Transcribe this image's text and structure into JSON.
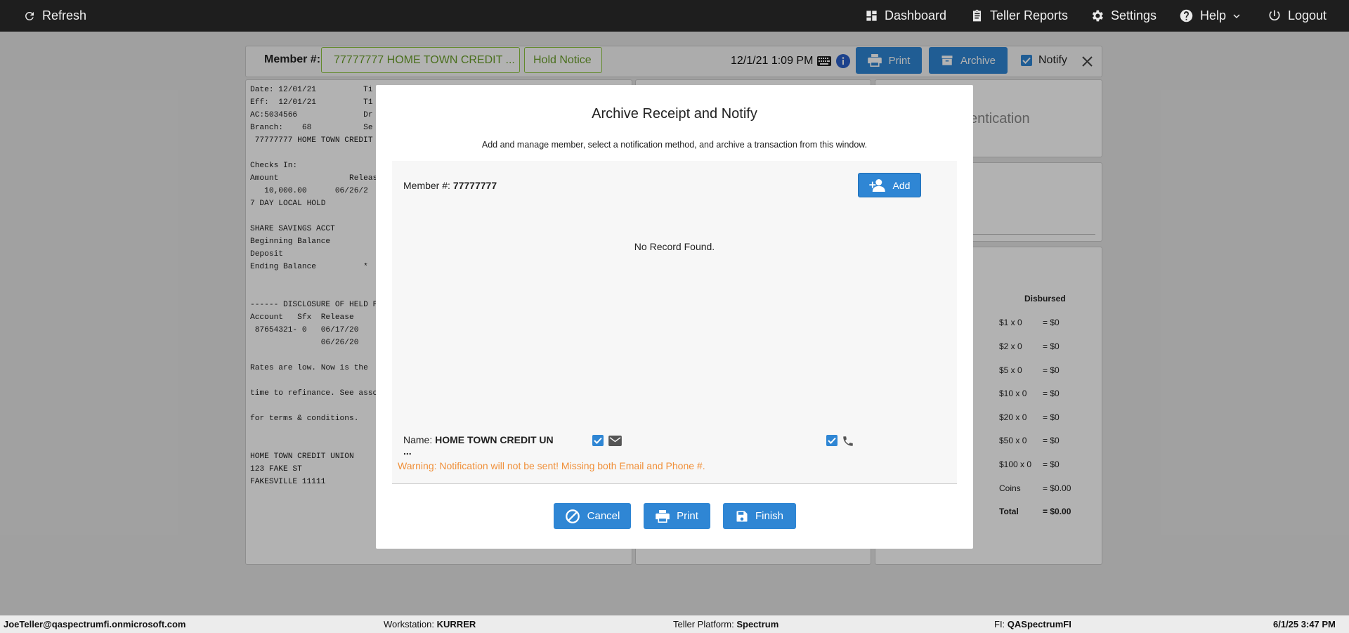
{
  "topbar": {
    "refresh": "Refresh",
    "dashboard": "Dashboard",
    "teller_reports": "Teller Reports",
    "settings": "Settings",
    "help": "Help",
    "logout": "Logout"
  },
  "toolbar": {
    "member_label": "Member #:",
    "member_value": "77777777 HOME TOWN CREDIT ...",
    "hold_notice": "Hold Notice",
    "datetime": "12/1/21 1:09 PM",
    "print": "Print",
    "archive": "Archive",
    "notify": "Notify"
  },
  "receipt_lines": [
    "Date: 12/01/21          Ti",
    "Eff:  12/01/21          T1",
    "AC:5034566              Dr",
    "Branch:    68           Se",
    " 77777777 HOME TOWN CREDIT",
    "",
    "Checks In:",
    "Amount               Releas",
    "   10,000.00      06/26/2",
    "7 DAY LOCAL HOLD",
    "",
    "SHARE SAVINGS ACCT",
    "Beginning Balance",
    "Deposit",
    "Ending Balance          *",
    "",
    "",
    "------ DISCLOSURE OF HELD F",
    "Account   Sfx  Release",
    " 87654321- 0   06/17/20",
    "               06/26/20",
    "",
    "Rates are low. Now is the",
    "",
    "time to refinance. See asso",
    "",
    "for terms & conditions.",
    "",
    "",
    "HOME TOWN CREDIT UNION",
    "123 FAKE ST",
    "FAKESVILLE 11111"
  ],
  "right_panel": {
    "auth_text": "entication",
    "disbursed_header": "Disbursed",
    "rows": [
      {
        "label": "$1 x 0",
        "value": "= $0"
      },
      {
        "label": "$2 x 0",
        "value": "= $0"
      },
      {
        "label": "$5 x 0",
        "value": "= $0"
      },
      {
        "label": "$10 x 0",
        "value": "= $0"
      },
      {
        "label": "$20 x 0",
        "value": "= $0"
      },
      {
        "label": "$50 x 0",
        "value": "= $0"
      },
      {
        "label": "$100 x 0",
        "value": "= $0"
      },
      {
        "label": "Coins",
        "value": "= $0.00"
      },
      {
        "label": "Total",
        "value": "= $0.00"
      }
    ]
  },
  "modal": {
    "title": "Archive Receipt and Notify",
    "subtitle": "Add and manage member, select a notification method, and archive a transaction from this window.",
    "member_label": "Member #:",
    "member_value": "77777777",
    "add": "Add",
    "no_record": "No Record Found.",
    "name_label": "Name:",
    "name_value": "HOME TOWN CREDIT UN",
    "name_more": "...",
    "warning": "Warning: Notification will not be sent! Missing both Email and Phone #.",
    "warning_color": "#f0903a",
    "cancel": "Cancel",
    "print": "Print",
    "finish": "Finish"
  },
  "statusbar": {
    "user": "JoeTeller@qaspectrumfi.onmicrosoft.com",
    "workstation_label": "Workstation:",
    "workstation": "KURRER",
    "platform_label": "Teller Platform:",
    "platform": "Spectrum",
    "fi_label": "FI:",
    "fi": "QASpectrumFI",
    "datetime": "6/1/25 3:47 PM"
  },
  "colors": {
    "accent": "#2f86d4",
    "member_green": "#8dc63f",
    "topbar": "#1e1e1e"
  }
}
